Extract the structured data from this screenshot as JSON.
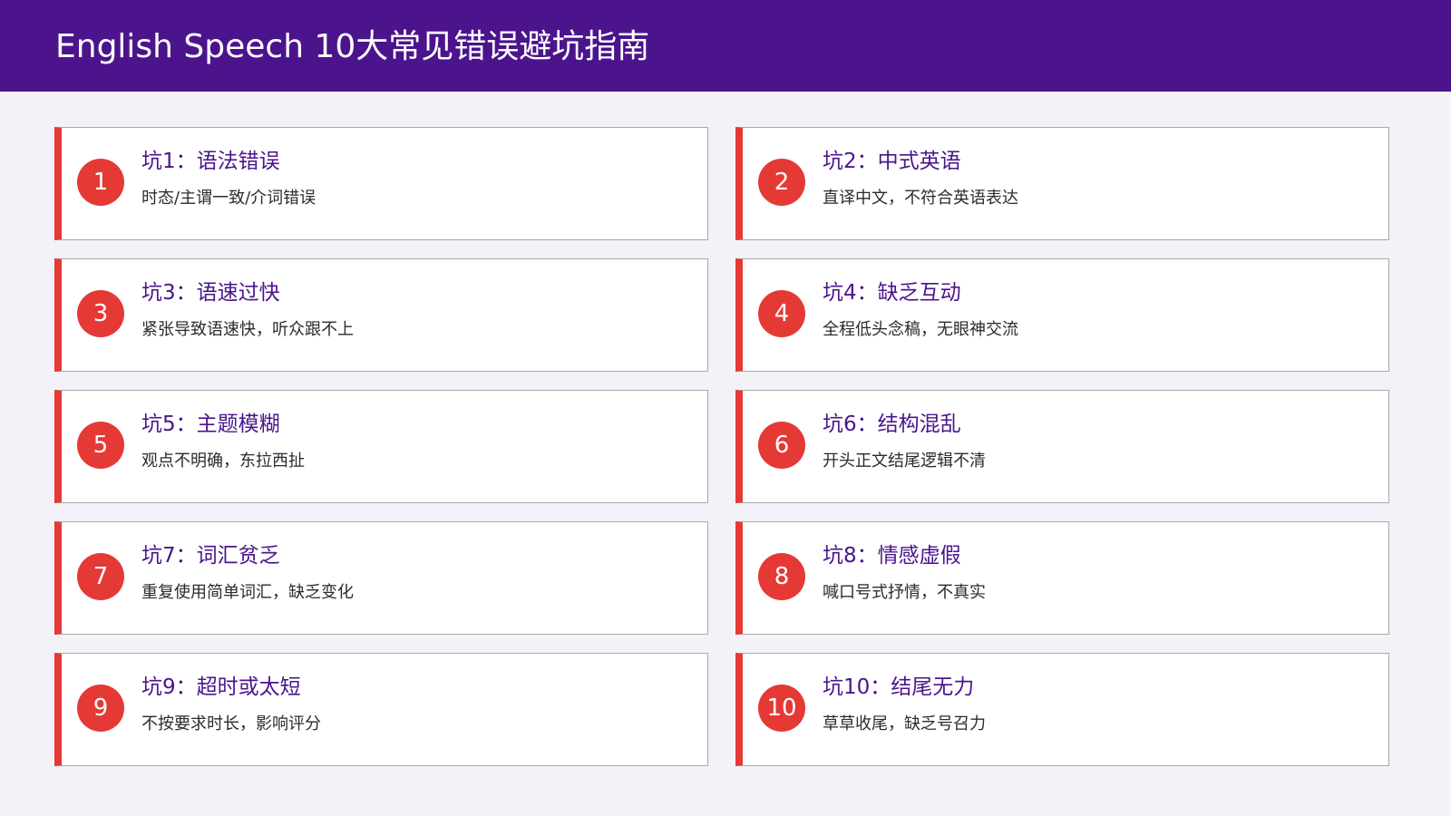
{
  "page": {
    "title": "English Speech 10大常见错误避坑指南"
  },
  "colors": {
    "header_bg": "#4b148c",
    "accent_red": "#e53935",
    "title_purple": "#4b148c",
    "page_bg": "#f3f2f8"
  },
  "pitfalls": [
    {
      "number": "1",
      "title": "坑1：语法错误",
      "description": "时态/主谓一致/介词错误"
    },
    {
      "number": "2",
      "title": "坑2：中式英语",
      "description": "直译中文，不符合英语表达"
    },
    {
      "number": "3",
      "title": "坑3：语速过快",
      "description": "紧张导致语速快，听众跟不上"
    },
    {
      "number": "4",
      "title": "坑4：缺乏互动",
      "description": "全程低头念稿，无眼神交流"
    },
    {
      "number": "5",
      "title": "坑5：主题模糊",
      "description": "观点不明确，东拉西扯"
    },
    {
      "number": "6",
      "title": "坑6：结构混乱",
      "description": "开头正文结尾逻辑不清"
    },
    {
      "number": "7",
      "title": "坑7：词汇贫乏",
      "description": "重复使用简单词汇，缺乏变化"
    },
    {
      "number": "8",
      "title": "坑8：情感虚假",
      "description": "喊口号式抒情，不真实"
    },
    {
      "number": "9",
      "title": "坑9：超时或太短",
      "description": "不按要求时长，影响评分"
    },
    {
      "number": "10",
      "title": "坑10：结尾无力",
      "description": "草草收尾，缺乏号召力"
    }
  ]
}
